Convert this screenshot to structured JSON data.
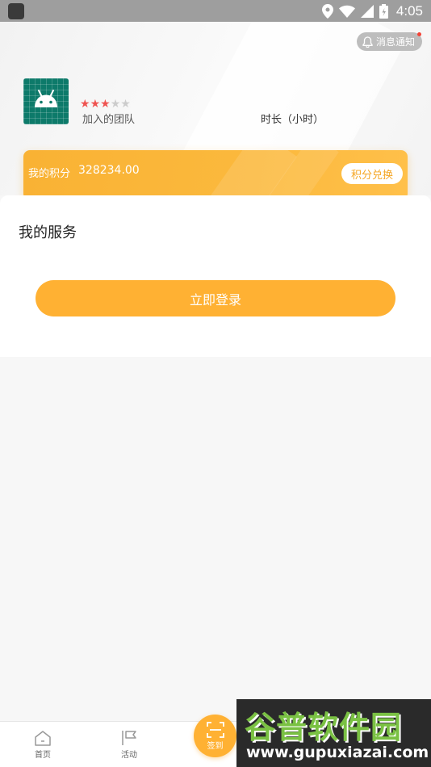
{
  "status_bar": {
    "time": "4:05"
  },
  "header": {
    "notify_label": "消息通知",
    "rating": {
      "filled": 3,
      "total": 5
    },
    "team_label": "加入的团队",
    "duration_label": "时长（小时）"
  },
  "points": {
    "label": "我的积分",
    "value": "328234.00",
    "exchange_label": "积分兑换"
  },
  "service": {
    "title": "我的服务",
    "login_label": "立即登录"
  },
  "bottom_nav": {
    "home_label": "首页",
    "activity_label": "活动",
    "sign_label": "签到"
  },
  "watermark": {
    "title": "谷普软件园",
    "url": "www.gupuxiazai.com"
  },
  "colors": {
    "accent": "#ffb133",
    "status_bar": "#9e9e9e",
    "star_filled": "#ef5350",
    "star_empty": "#cccccc",
    "avatar_bg": "#0d7a6a"
  }
}
